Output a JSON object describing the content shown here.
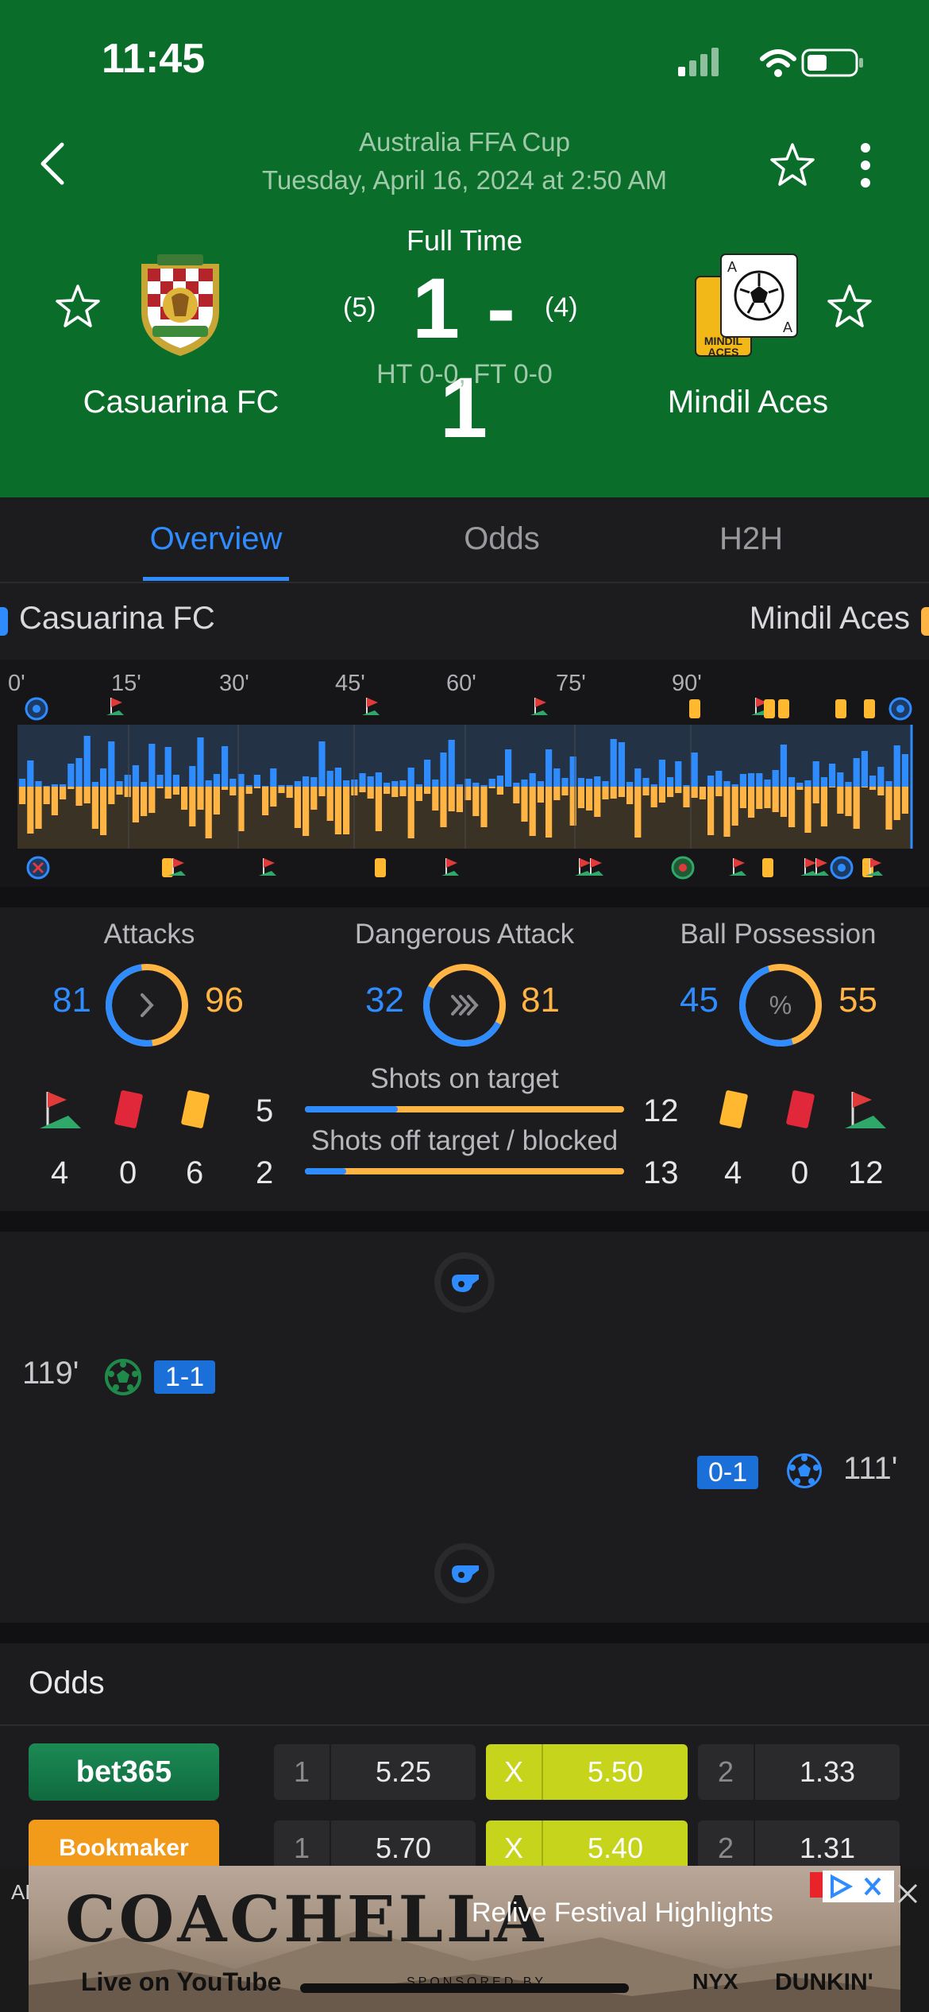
{
  "status_bar": {
    "time": "11:45"
  },
  "header": {
    "competition": "Australia FFA Cup",
    "datetime": "Tuesday, April 16, 2024 at 2:50 AM",
    "status": "Full Time",
    "score": "1 - 1",
    "home_penalties": "(5)",
    "away_penalties": "(4)",
    "ht_ft": "HT 0-0, FT 0-0",
    "home_team": "Casuarina FC",
    "away_team": "Mindil Aces",
    "away_logo_text": "MINDIL ACES"
  },
  "tabs": [
    {
      "label": "Overview",
      "active": true
    },
    {
      "label": "Odds",
      "active": false
    },
    {
      "label": "H2H",
      "active": false
    }
  ],
  "teams_row": {
    "home": "Casuarina FC",
    "away": "Mindil Aces"
  },
  "timeline": {
    "ticks": [
      "0'",
      "15'",
      "30'",
      "45'",
      "60'",
      "75'",
      "90'"
    ],
    "home_color": "#2f8cff",
    "away_color": "#ffb444"
  },
  "stats": {
    "attacks": {
      "label": "Attacks",
      "home": "81",
      "away": "96"
    },
    "dangerous_attack": {
      "label": "Dangerous Attack",
      "home": "32",
      "away": "81"
    },
    "ball_possession": {
      "label": "Ball Possession",
      "home": "45",
      "away": "55"
    },
    "home_corners": "4",
    "home_red": "0",
    "home_yellow": "6",
    "away_yellow": "4",
    "away_red": "0",
    "away_corners": "12",
    "shots_on": {
      "label": "Shots on target",
      "home": "5",
      "away": "12"
    },
    "shots_off": {
      "label": "Shots off target / blocked",
      "home": "2",
      "away": "13"
    }
  },
  "events": [
    {
      "minute": "119'",
      "side": "home",
      "score": "1-1"
    },
    {
      "minute": "111'",
      "side": "away",
      "score": "0-1"
    }
  ],
  "odds": {
    "title": "Odds",
    "rows": [
      {
        "bookmaker": "bet365",
        "one_label": "1",
        "one": "5.25",
        "x_label": "X",
        "x": "5.50",
        "two_label": "2",
        "two": "1.33"
      },
      {
        "bookmaker": "Bookmaker",
        "one_label": "1",
        "one": "5.70",
        "x_label": "X",
        "x": "5.40",
        "two_label": "2",
        "two": "1.31"
      }
    ]
  },
  "ad": {
    "label": "AD",
    "headline": "COACHELLA",
    "tagline": "Relive Festival Highlights",
    "sub": "Live on YouTube",
    "sponsored": "SPONSORED BY",
    "sponsor1": "NYX",
    "sponsor2": "DUNKIN'"
  }
}
